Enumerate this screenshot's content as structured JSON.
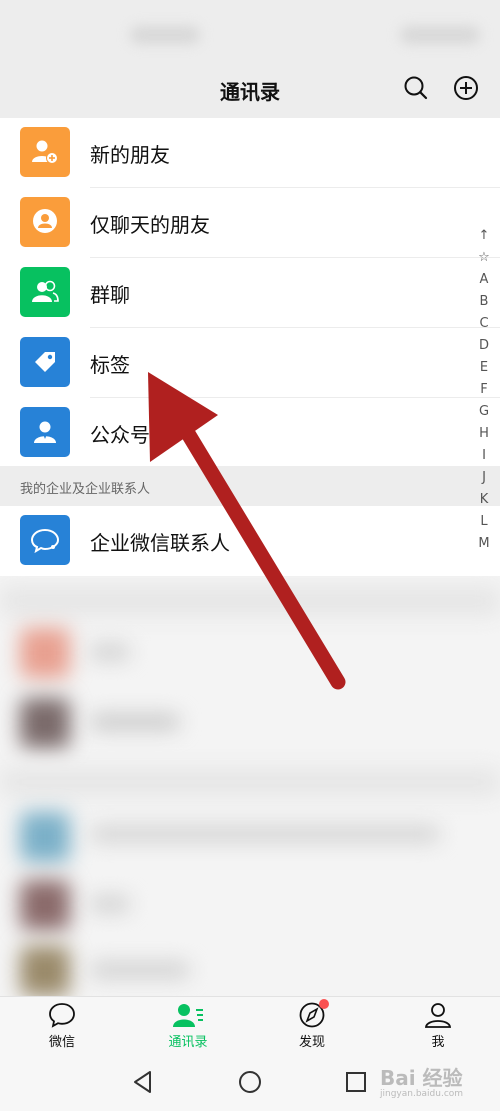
{
  "header": {
    "title": "通讯录",
    "search_icon": "search-icon",
    "add_icon": "plus-circle-icon"
  },
  "rows": [
    {
      "label": "新的朋友",
      "color": "#fa9d3b",
      "icon": "add-friend-icon"
    },
    {
      "label": "仅聊天的朋友",
      "color": "#fa9d3b",
      "icon": "chat-only-icon"
    },
    {
      "label": "群聊",
      "color": "#07c160",
      "icon": "group-icon"
    },
    {
      "label": "标签",
      "color": "#2782d7",
      "icon": "tag-icon"
    },
    {
      "label": "公众号",
      "color": "#2782d7",
      "icon": "official-account-icon"
    }
  ],
  "section": {
    "title": "我的企业及企业联系人"
  },
  "enterprise": {
    "label": "企业微信联系人",
    "color": "#2782d7",
    "icon": "enterprise-chat-icon"
  },
  "index": [
    "↑",
    "☆",
    "A",
    "B",
    "C",
    "D",
    "E",
    "F",
    "G",
    "H",
    "I",
    "J",
    "K",
    "L",
    "M"
  ],
  "tabs": [
    {
      "label": "微信",
      "icon": "chat-bubble-icon",
      "active": false
    },
    {
      "label": "通讯录",
      "icon": "contacts-icon",
      "active": true
    },
    {
      "label": "发现",
      "icon": "compass-icon",
      "active": false,
      "badge": true
    },
    {
      "label": "我",
      "icon": "person-icon",
      "active": false
    }
  ],
  "colors": {
    "accent": "#07c160",
    "annotation_arrow": "#b0201f",
    "badge": "#fa5151"
  },
  "watermark": {
    "text": "Bai 经验",
    "sub": "jingyan.baidu.com"
  }
}
